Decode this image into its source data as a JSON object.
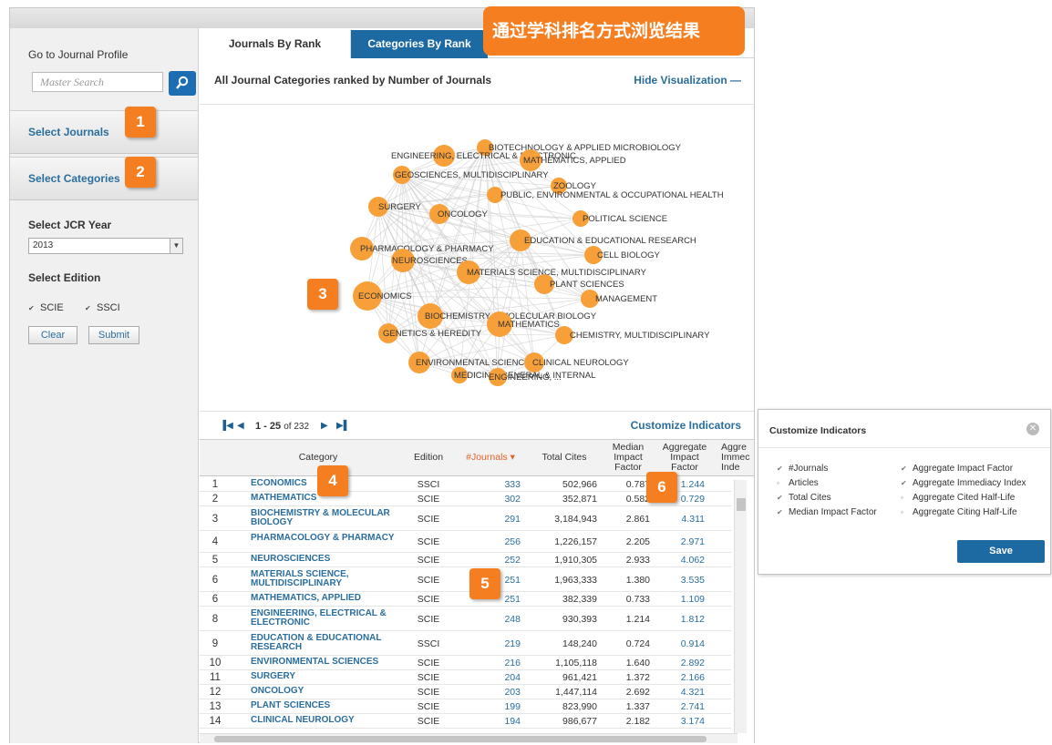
{
  "sidebar": {
    "title": "Go to Journal Profile",
    "search_placeholder": "Master Search",
    "nav_journals": "Select Journals",
    "nav_categories": "Select Categories",
    "year_label": "Select JCR Year",
    "year_value": "2013",
    "edition_label": "Select Edition",
    "editions": [
      "SCIE",
      "SSCI"
    ],
    "clear": "Clear",
    "submit": "Submit"
  },
  "tabs": {
    "rank": "Journals By Rank",
    "categories": "Categories By Rank"
  },
  "banner": "通过学科排名方式浏览结果",
  "subheader": {
    "title": "All Journal Categories ranked by Number of Journals",
    "hide": "Hide Visualization"
  },
  "badges": [
    "1",
    "2",
    "3",
    "4",
    "5",
    "6"
  ],
  "visualization": {
    "nodes": [
      {
        "label": "BIOTECHNOLOGY & APPLIED MICROBIOLOGY"
      },
      {
        "label": "ENGINEERING, ELECTRICAL & ELECTRONIC"
      },
      {
        "label": "MATHEMATICS, APPLIED"
      },
      {
        "label": "GEOSCIENCES, MULTIDISCIPLINARY"
      },
      {
        "label": "ZOOLOGY"
      },
      {
        "label": "PUBLIC, ENVIRONMENTAL & OCCUPATIONAL HEALTH"
      },
      {
        "label": "SURGERY"
      },
      {
        "label": "ONCOLOGY"
      },
      {
        "label": "POLITICAL SCIENCE"
      },
      {
        "label": "EDUCATION & EDUCATIONAL RESEARCH"
      },
      {
        "label": "PHARMACOLOGY & PHARMACY"
      },
      {
        "label": "CELL BIOLOGY"
      },
      {
        "label": "NEUROSCIENCES"
      },
      {
        "label": "MATERIALS SCIENCE, MULTIDISCIPLINARY"
      },
      {
        "label": "PLANT SCIENCES"
      },
      {
        "label": "ECONOMICS"
      },
      {
        "label": "MANAGEMENT"
      },
      {
        "label": "BIOCHEMISTRY & MOLECULAR BIOLOGY"
      },
      {
        "label": "MATHEMATICS"
      },
      {
        "label": "GENETICS & HEREDITY"
      },
      {
        "label": "CHEMISTRY, MULTIDISCIPLINARY"
      },
      {
        "label": "ENVIRONMENTAL SCIENCES"
      },
      {
        "label": "CLINICAL NEUROLOGY"
      },
      {
        "label": "MEDICINE, GENERAL & INTERNAL"
      },
      {
        "label": "ENGINEERING, ..."
      }
    ]
  },
  "pager": {
    "range": "1 - 25",
    "of": "of 232",
    "customize": "Customize Indicators"
  },
  "table": {
    "headers": {
      "category": "Category",
      "edition": "Edition",
      "journals": "#Journals",
      "total_cites": "Total Cites",
      "median_if": [
        "Median",
        "Impact",
        "Factor"
      ],
      "agg_if": [
        "Aggregate",
        "Impact",
        "Factor"
      ],
      "agg_imm": [
        "Aggre",
        "Immec",
        "Inde"
      ]
    },
    "rows": [
      {
        "rank": "1",
        "category": "ECONOMICS",
        "edition": "SSCI",
        "journals": "333",
        "cites": "502,966",
        "mif": "0.787",
        "aif": "1.244"
      },
      {
        "rank": "2",
        "category": "MATHEMATICS",
        "edition": "SCIE",
        "journals": "302",
        "cites": "352,871",
        "mif": "0.582",
        "aif": "0.729"
      },
      {
        "rank": "3",
        "category": "BIOCHEMISTRY & MOLECULAR BIOLOGY",
        "edition": "SCIE",
        "journals": "291",
        "cites": "3,184,943",
        "mif": "2.861",
        "aif": "4.311"
      },
      {
        "rank": "4",
        "category": "PHARMACOLOGY & PHARMACY",
        "edition": "SCIE",
        "journals": "256",
        "cites": "1,226,157",
        "mif": "2.205",
        "aif": "2.971"
      },
      {
        "rank": "5",
        "category": "NEUROSCIENCES",
        "edition": "SCIE",
        "journals": "252",
        "cites": "1,910,305",
        "mif": "2.933",
        "aif": "4.062"
      },
      {
        "rank": "6",
        "category": "MATERIALS SCIENCE, MULTIDISCIPLINARY",
        "edition": "SCIE",
        "journals": "251",
        "cites": "1,963,333",
        "mif": "1.380",
        "aif": "3.535"
      },
      {
        "rank": "6",
        "category": "MATHEMATICS, APPLIED",
        "edition": "SCIE",
        "journals": "251",
        "cites": "382,339",
        "mif": "0.733",
        "aif": "1.109"
      },
      {
        "rank": "8",
        "category": "ENGINEERING, ELECTRICAL & ELECTRONIC",
        "edition": "SCIE",
        "journals": "248",
        "cites": "930,393",
        "mif": "1.214",
        "aif": "1.812"
      },
      {
        "rank": "9",
        "category": "EDUCATION & EDUCATIONAL RESEARCH",
        "edition": "SSCI",
        "journals": "219",
        "cites": "148,240",
        "mif": "0.724",
        "aif": "0.914"
      },
      {
        "rank": "10",
        "category": "ENVIRONMENTAL SCIENCES",
        "edition": "SCIE",
        "journals": "216",
        "cites": "1,105,118",
        "mif": "1.640",
        "aif": "2.892"
      },
      {
        "rank": "11",
        "category": "SURGERY",
        "edition": "SCIE",
        "journals": "204",
        "cites": "961,421",
        "mif": "1.372",
        "aif": "2.166"
      },
      {
        "rank": "12",
        "category": "ONCOLOGY",
        "edition": "SCIE",
        "journals": "203",
        "cites": "1,447,114",
        "mif": "2.692",
        "aif": "4.321"
      },
      {
        "rank": "13",
        "category": "PLANT SCIENCES",
        "edition": "SCIE",
        "journals": "199",
        "cites": "823,990",
        "mif": "1.337",
        "aif": "2.741"
      },
      {
        "rank": "14",
        "category": "CLINICAL NEUROLOGY",
        "edition": "SCIE",
        "journals": "194",
        "cites": "986,677",
        "mif": "2.182",
        "aif": "3.174"
      }
    ]
  },
  "customize_panel": {
    "title": "Customize Indicators",
    "left_options": [
      {
        "label": "#Journals",
        "checked": true
      },
      {
        "label": "Articles",
        "checked": false
      },
      {
        "label": "Total Cites",
        "checked": true
      },
      {
        "label": "Median Impact Factor",
        "checked": true
      }
    ],
    "right_options": [
      {
        "label": "Aggregate Impact Factor",
        "checked": true
      },
      {
        "label": "Aggregate Immediacy Index",
        "checked": true
      },
      {
        "label": "Aggregate Cited Half-Life",
        "checked": false
      },
      {
        "label": "Aggregate Citing Half-Life",
        "checked": false
      }
    ],
    "save": "Save"
  },
  "colors": {
    "accent": "#1d6aa2",
    "badge": "#f57f20",
    "node": "#f7a03a",
    "link": "#2a6e9e"
  }
}
